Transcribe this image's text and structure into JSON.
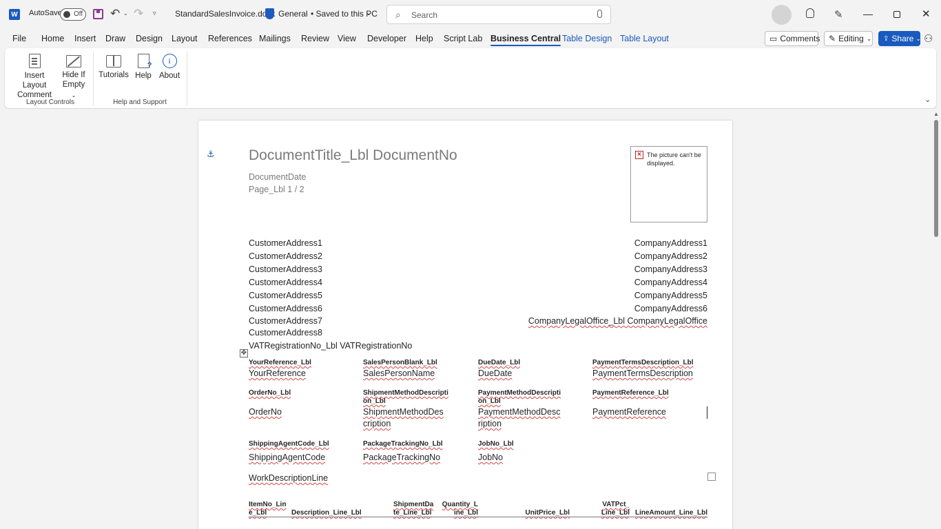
{
  "titlebar": {
    "app_letter": "W",
    "autosave_label": "AutoSave",
    "autosave_state": "Off",
    "document_name": "StandardSalesInvoice.docx",
    "sensitivity": "General",
    "saved_status": "• Saved to this PC",
    "search_placeholder": "Search"
  },
  "tabs": [
    {
      "label": "File"
    },
    {
      "label": "Home"
    },
    {
      "label": "Insert"
    },
    {
      "label": "Draw"
    },
    {
      "label": "Design"
    },
    {
      "label": "Layout"
    },
    {
      "label": "References"
    },
    {
      "label": "Mailings"
    },
    {
      "label": "Review"
    },
    {
      "label": "View"
    },
    {
      "label": "Developer"
    },
    {
      "label": "Help"
    },
    {
      "label": "Script Lab"
    },
    {
      "label": "Business Central"
    },
    {
      "label": "Table Design"
    },
    {
      "label": "Table Layout"
    }
  ],
  "header_buttons": {
    "comments": "Comments",
    "editing": "Editing",
    "share": "Share"
  },
  "ribbon": {
    "insert_layout_comment": [
      "Insert Layout",
      "Comment"
    ],
    "hide_if_empty": [
      "Hide If",
      "Empty"
    ],
    "tutorials": "Tutorials",
    "help": "Help",
    "about": "About",
    "group_layout_controls": "Layout Controls",
    "group_help_support": "Help and Support"
  },
  "document": {
    "title": "DocumentTitle_Lbl DocumentNo",
    "date": "DocumentDate",
    "page": "Page_Lbl  1 / 2",
    "picture_error": "The picture can't be displayed.",
    "customer_address": [
      "CustomerAddress1",
      "CustomerAddress2",
      "CustomerAddress3",
      "CustomerAddress4",
      "CustomerAddress5",
      "CustomerAddress6",
      "CustomerAddress7",
      "CustomerAddress8"
    ],
    "vat_line": "VATRegistrationNo_Lbl VATRegistrationNo",
    "company_address": [
      "CompanyAddress1",
      "CompanyAddress2",
      "CompanyAddress3",
      "CompanyAddress4",
      "CompanyAddress5",
      "CompanyAddress6"
    ],
    "company_legal_office": "CompanyLegalOffice_Lbl CompanyLegalOffice",
    "info_row1_labels": [
      "YourReference_Lbl",
      "SalesPersonBlank_Lbl",
      "DueDate_Lbl",
      "PaymentTermsDescription_Lbl"
    ],
    "info_row1_values": [
      "YourReference",
      "SalesPersonName",
      "DueDate",
      "PaymentTermsDescription"
    ],
    "info_row2_labels": [
      "OrderNo_Lbl",
      [
        "ShipmentMethodDescripti",
        "on_Lbl"
      ],
      [
        "PaymentMethodDescripti",
        "on_Lbl"
      ],
      "PaymentReference_Lbl"
    ],
    "info_row2_values": [
      "OrderNo",
      [
        "ShipmentMethodDes",
        "cription"
      ],
      [
        "PaymentMethodDesc",
        "ription"
      ],
      "PaymentReference"
    ],
    "info_row3_labels": [
      "ShippingAgentCode_Lbl",
      "PackageTrackingNo_Lbl",
      "JobNo_Lbl"
    ],
    "info_row3_values": [
      "ShippingAgentCode",
      "PackageTrackingNo",
      "JobNo"
    ],
    "work_description": "WorkDescriptionLine",
    "line_headers": [
      [
        "ItemNo_Lin",
        "e_Lbl"
      ],
      [
        "Description_Line_Lbl"
      ],
      [
        "ShipmentDa",
        "te_Line_Lbl"
      ],
      [
        "Quantity_L",
        "ine_Lbl"
      ],
      [
        "UnitPrice_Lbl"
      ],
      [
        "VATPct_",
        "Line_Lbl"
      ],
      [
        "LineAmount_Line_Lbl"
      ]
    ]
  }
}
